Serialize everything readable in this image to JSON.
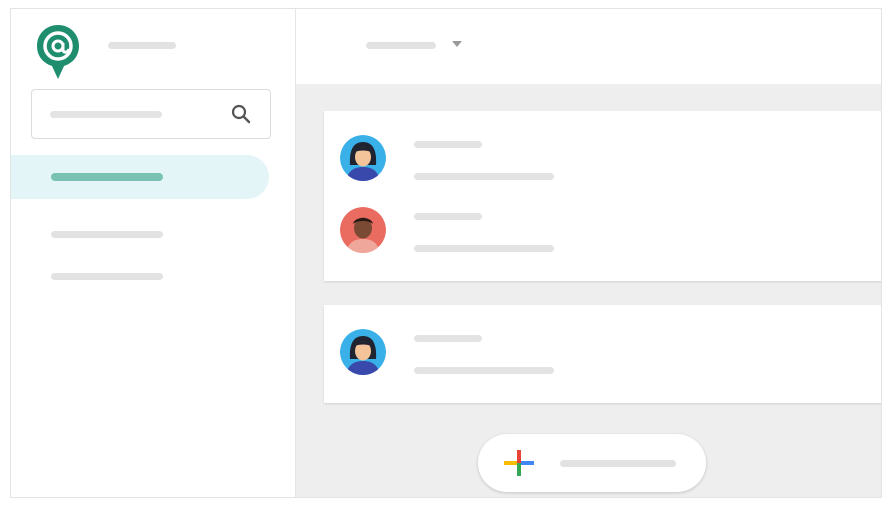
{
  "app": {
    "logo_icon": "chat-at-logo-icon",
    "brand_color": "#1e8e6e"
  },
  "sidebar": {
    "search_icon": "search-icon",
    "items": [
      {
        "state": "active",
        "accent": "#79c2b3"
      },
      {
        "state": "inactive"
      },
      {
        "state": "inactive"
      }
    ]
  },
  "topbar": {
    "dropdown_icon": "chevron-down-icon"
  },
  "messages": [
    {
      "card": 1,
      "avatar": "woman-avatar-icon",
      "avatar_bg": "#3ab0e8"
    },
    {
      "card": 1,
      "avatar": "man-avatar-icon",
      "avatar_bg": "#ea6b5f"
    },
    {
      "card": 2,
      "avatar": "woman-avatar-icon",
      "avatar_bg": "#3ab0e8"
    }
  ],
  "compose": {
    "icon": "multicolor-plus-icon",
    "colors": {
      "red": "#ea4335",
      "blue": "#4285f4",
      "green": "#34a853",
      "yellow": "#fbbc05"
    }
  }
}
